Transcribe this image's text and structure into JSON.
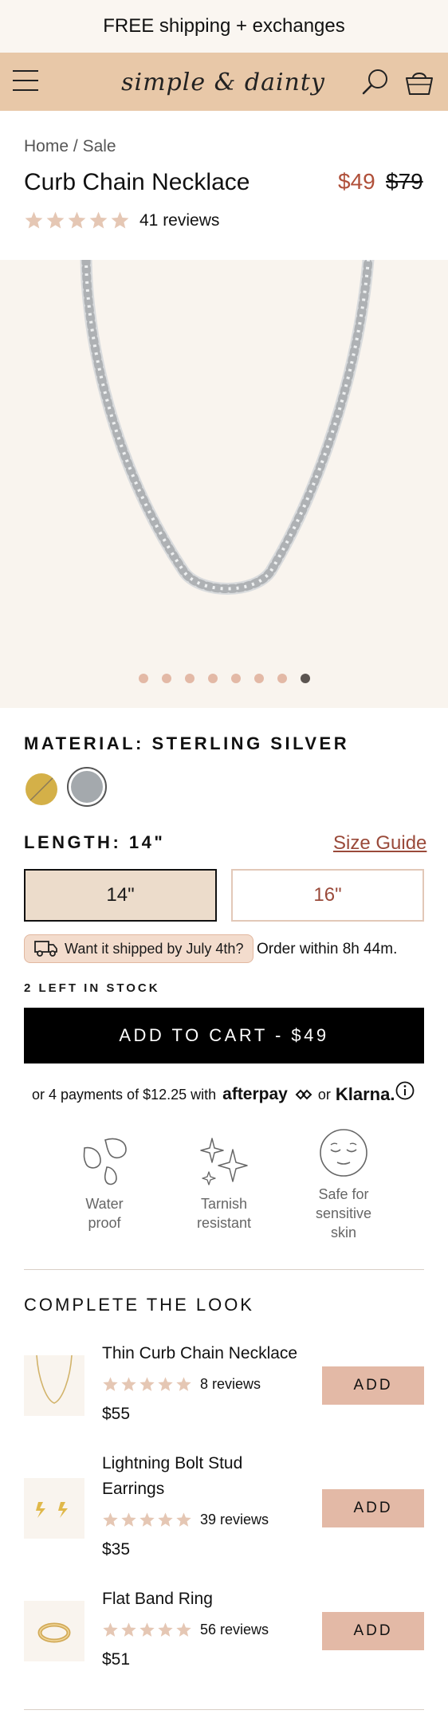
{
  "announcement": "FREE shipping + exchanges",
  "header": {
    "logo": "simple & dainty",
    "menu_icon": "hamburger-menu-icon",
    "search_icon": "search-icon",
    "bag_icon": "shopping-bag-icon"
  },
  "breadcrumb": {
    "home": "Home",
    "separator": "/",
    "current": "Sale"
  },
  "product": {
    "title": "Curb Chain Necklace",
    "price_sale": "$49",
    "price_original": "$79",
    "rating": 5,
    "reviews": "41 reviews"
  },
  "gallery": {
    "image_count": 8,
    "active_index": 7
  },
  "material": {
    "label": "MATERIAL: STERLING SILVER",
    "swatches": [
      {
        "name": "gold",
        "color": "#d4b048",
        "selected": false
      },
      {
        "name": "sterling silver",
        "color": "#a4a9ad",
        "selected": true
      }
    ]
  },
  "length": {
    "label": "LENGTH: 14\"",
    "size_guide": "Size Guide",
    "options": [
      {
        "label": "14\"",
        "selected": true
      },
      {
        "label": "16\"",
        "selected": false
      }
    ]
  },
  "shipping": {
    "pill": "Want it shipped by July 4th?",
    "order_within": "Order within 8h 44m."
  },
  "stock": "2 LEFT IN STOCK",
  "cart_button": "ADD TO CART - $49",
  "payments": {
    "prefix": "or 4 payments of $12.25 with",
    "afterpay": "afterpay",
    "or": "or",
    "klarna": "Klarna."
  },
  "features": [
    {
      "icon": "water-drops-icon",
      "lines": [
        "Water",
        "proof"
      ]
    },
    {
      "icon": "sparkles-icon",
      "lines": [
        "Tarnish",
        "resistant"
      ]
    },
    {
      "icon": "calm-face-icon",
      "lines": [
        "Safe for",
        "sensitive",
        "skin"
      ]
    }
  ],
  "complete_the_look": {
    "heading": "COMPLETE THE LOOK",
    "items": [
      {
        "name": "Thin Curb Chain Necklace",
        "reviews": "8 reviews",
        "price": "$55",
        "button": "ADD"
      },
      {
        "name": "Lightning Bolt Stud Earrings",
        "reviews": "39 reviews",
        "price": "$35",
        "button": "ADD"
      },
      {
        "name": "Flat Band Ring",
        "reviews": "56 reviews",
        "price": "$51",
        "button": "ADD"
      }
    ]
  },
  "colors": {
    "header_bg": "#e8c8a8",
    "announcement_bg": "#faf6f1",
    "sale_price": "#b0503a",
    "accent_pink": "#e3b9a6",
    "star": "#e5c7b4",
    "selected_length_bg": "#ecdccb"
  }
}
